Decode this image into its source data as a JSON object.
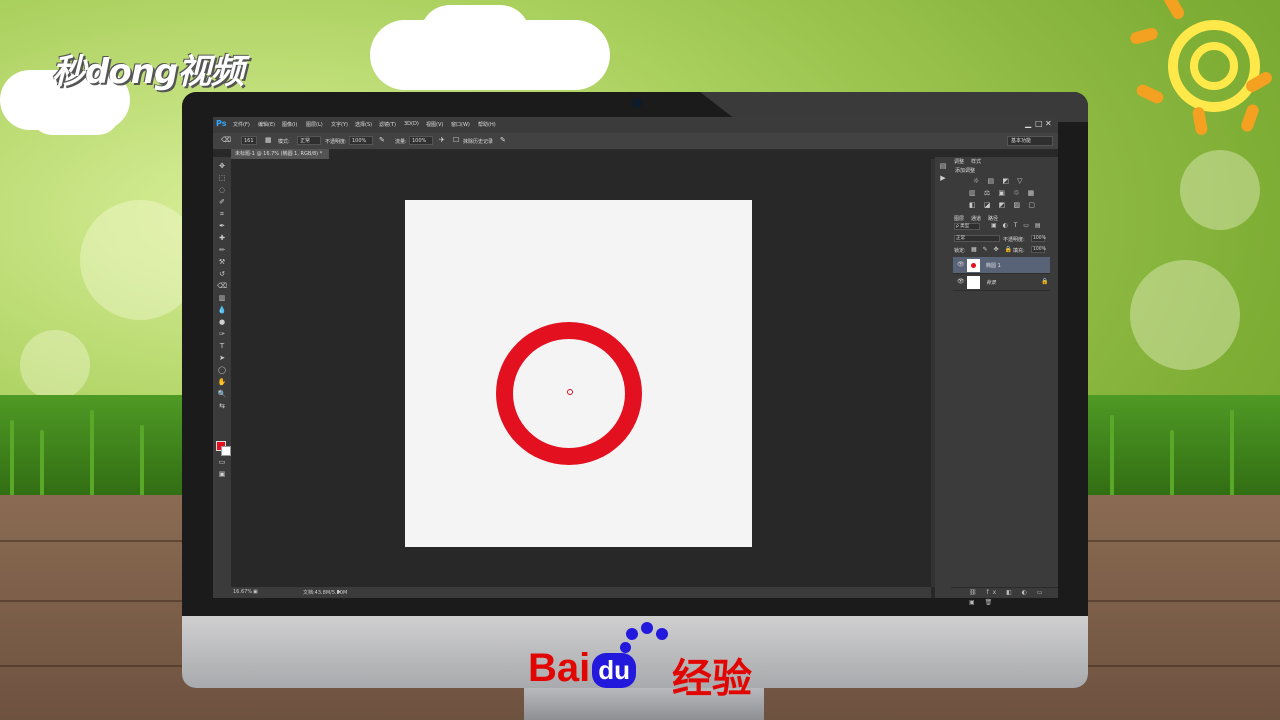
{
  "branding": {
    "top_logo": "秒dong视频",
    "baidu_bai": "Bai",
    "baidu_du": "du",
    "baidu_jingyan": "经验"
  },
  "app": {
    "logo": "Ps",
    "menu": [
      "文件(F)",
      "编辑(E)",
      "图像(I)",
      "图层(L)",
      "文字(Y)",
      "选择(S)",
      "滤镜(T)",
      "3D(D)",
      "视图(V)",
      "窗口(W)",
      "帮助(H)"
    ],
    "window_buttons": [
      "▁",
      "□",
      "✕"
    ],
    "workspace": "基本功能"
  },
  "options": {
    "brush_size": "161",
    "mode_label": "模式:",
    "mode_value": "正常",
    "opacity_label": "不透明度:",
    "opacity_value": "100%",
    "flow_label": "流量:",
    "flow_value": "100%",
    "history_label": "抹除历史记录"
  },
  "document": {
    "tab_title": "未标题-1 @ 16.7% (椭圆 1, RGB/8) *",
    "ring_color": "#e3101f"
  },
  "status": {
    "zoom": "16.67%",
    "doc_size": "文档:43.8M/5.50M"
  },
  "panels": {
    "top_tabs": [
      "调整",
      "样式"
    ],
    "adjust_label": "添加调整",
    "adjust_row1": "☼ ▤ ◩ ▽",
    "adjust_row2": "▥ ⚖ ▣ ♲ ▦",
    "adjust_row3": "◧ ◪ ◩ ▨ ▢",
    "layer_tabs": [
      "图层",
      "通道",
      "路径"
    ],
    "kind_label": "ρ 类型",
    "blend_mode": "正常",
    "opacity_label": "不透明度:",
    "opacity_value": "100%",
    "lock_label": "锁定:",
    "fill_label": "填充:",
    "fill_value": "100%",
    "layers": [
      {
        "name": "椭圆 1"
      },
      {
        "name": "背景"
      }
    ],
    "footer_icons": "⛓ fx ◧ ◐ ▭ ▣ 🗑"
  }
}
